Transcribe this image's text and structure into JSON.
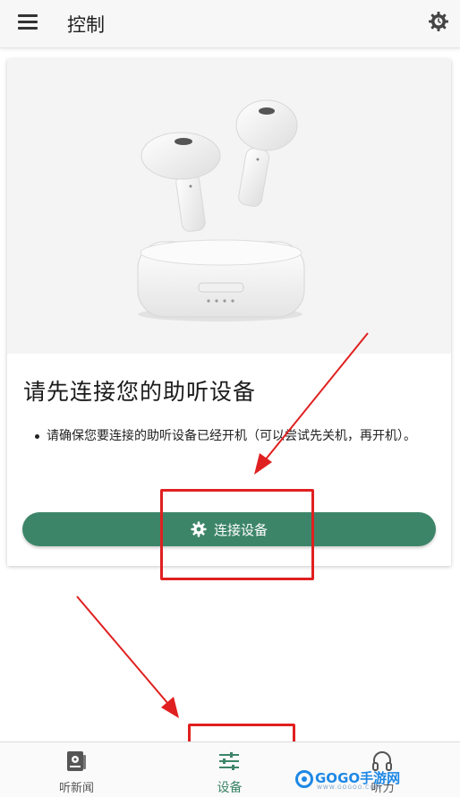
{
  "appbar": {
    "title": "控制",
    "menu_icon": "hamburger-menu-icon",
    "settings_icon": "settings-gear-icon"
  },
  "card": {
    "image": "wireless-earbuds-with-charging-case",
    "title": "请先连接您的助听设备",
    "bullet": "请确保您要连接的助听设备已经开机（可以尝试先关机，再开机）。",
    "connect_button": {
      "label": "连接设备",
      "icon": "gear-icon"
    }
  },
  "bottom_nav": {
    "items": [
      {
        "label": "听新闻",
        "icon": "news-player-icon",
        "active": false
      },
      {
        "label": "设备",
        "icon": "sliders-icon",
        "active": true
      },
      {
        "label": "听力",
        "icon": "headphones-icon",
        "active": false
      }
    ]
  },
  "watermark": {
    "text": "GOGO手游网",
    "sub": "WWW.GOGOO.COM"
  },
  "colors": {
    "accent": "#3d8569",
    "annotation_red": "#e02020",
    "appbar_bg": "#f7f7f7"
  }
}
